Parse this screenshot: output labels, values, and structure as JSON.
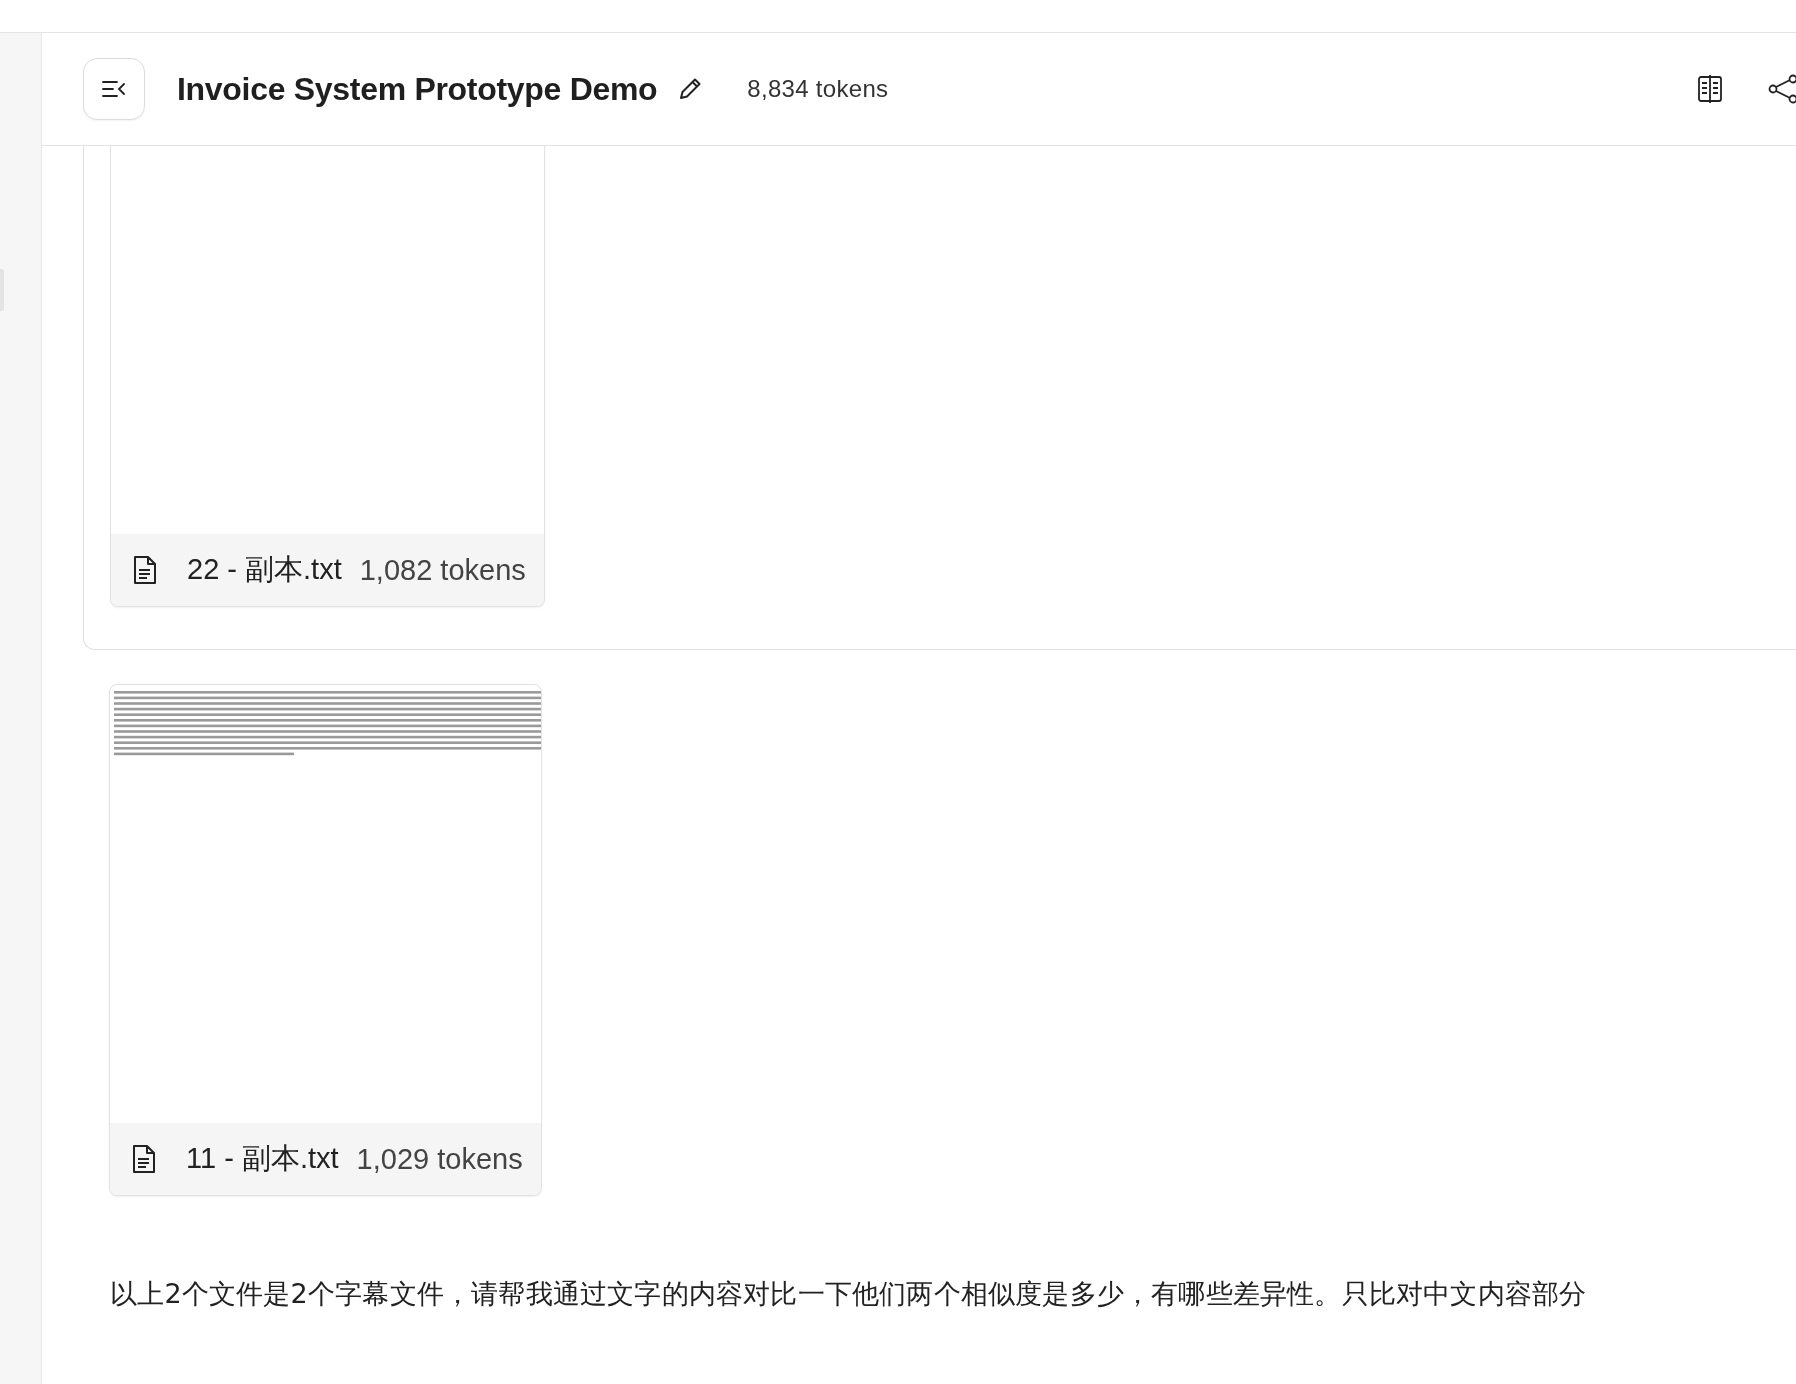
{
  "header": {
    "title": "Invoice System Prototype Demo",
    "token_count": "8,834 tokens"
  },
  "previous_message": {
    "attachments": [
      {
        "name": "22 - 副本.txt",
        "tokens": "1,082 tokens"
      }
    ]
  },
  "current_message": {
    "attachments": [
      {
        "name": "11 - 副本.txt",
        "tokens": "1,029 tokens"
      }
    ],
    "text": "以上2个文件是2个字幕文件，请帮我通过文字的内容对比一下他们两个相似度是多少，有哪些差异性。只比对中文内容部分"
  }
}
